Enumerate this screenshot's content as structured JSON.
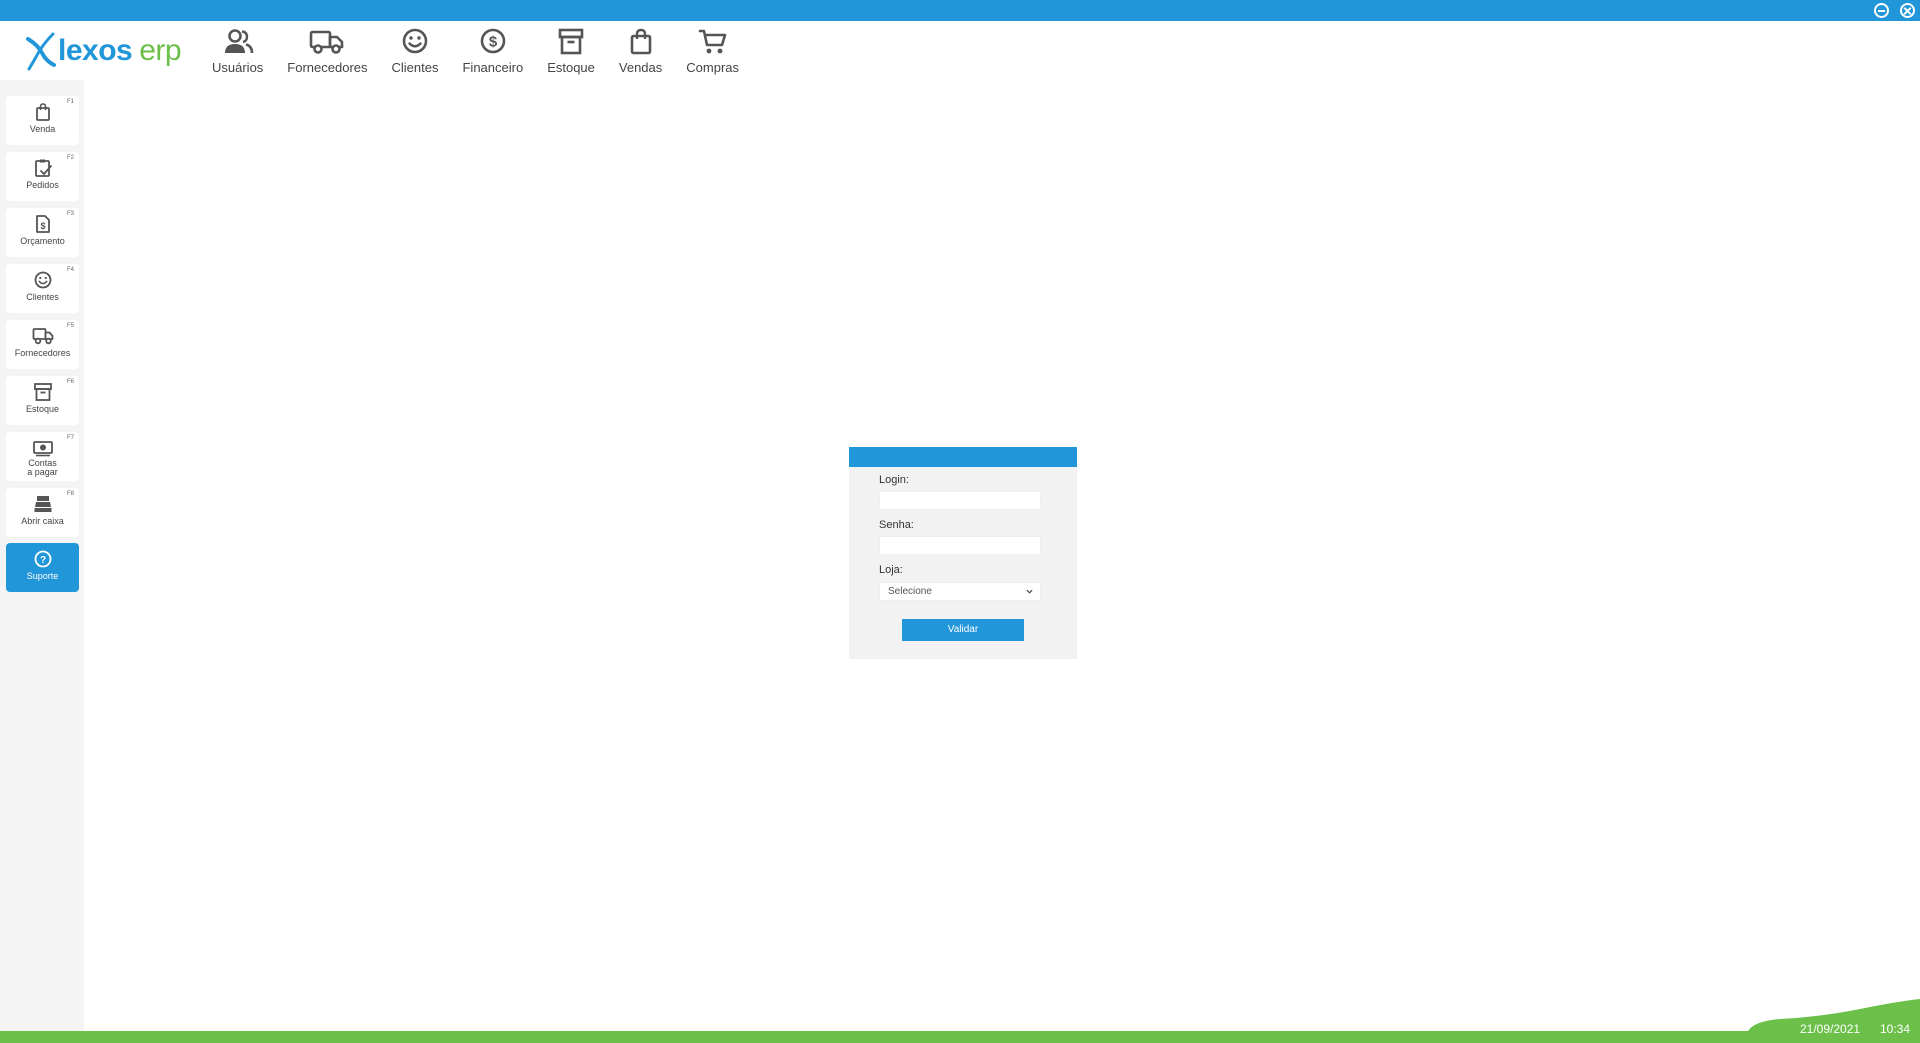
{
  "brand": {
    "logo_name": "lexos",
    "logo_suffix": "erp",
    "primary_color": "#2196d9",
    "accent_color": "#6cc04a"
  },
  "window_controls": [
    "minimize-icon",
    "close-icon"
  ],
  "topnav": {
    "items": [
      {
        "label": "Usuários",
        "icon": "users-icon"
      },
      {
        "label": "Fornecedores",
        "icon": "truck-icon"
      },
      {
        "label": "Clientes",
        "icon": "smile-icon"
      },
      {
        "label": "Financeiro",
        "icon": "dollar-icon"
      },
      {
        "label": "Estoque",
        "icon": "archive-icon"
      },
      {
        "label": "Vendas",
        "icon": "shopping-bag-icon"
      },
      {
        "label": "Compras",
        "icon": "cart-icon"
      }
    ]
  },
  "sidebar": {
    "items": [
      {
        "label": "Venda",
        "key": "F1",
        "icon": "shopping-bag-icon"
      },
      {
        "label": "Pedidos",
        "key": "F2",
        "icon": "clipboard-check-icon"
      },
      {
        "label": "Orçamento",
        "key": "F3",
        "icon": "invoice-icon"
      },
      {
        "label": "Clientes",
        "key": "F4",
        "icon": "smile-icon"
      },
      {
        "label": "Fornecedores",
        "key": "F5",
        "icon": "truck-icon"
      },
      {
        "label": "Estoque",
        "key": "F6",
        "icon": "archive-icon"
      },
      {
        "label_line1": "Contas",
        "label_line2": "a pagar",
        "key": "F7",
        "icon": "money-icon"
      },
      {
        "label": "Abrir caixa",
        "key": "F8",
        "icon": "cash-register-icon"
      },
      {
        "label": "Suporte",
        "icon": "help-icon",
        "active": true
      }
    ]
  },
  "login": {
    "login_label": "Login:",
    "password_label": "Senha:",
    "store_label": "Loja:",
    "store_select": "Selecione",
    "submit_label": "Validar"
  },
  "status": {
    "date": "21/09/2021",
    "time": "10:34"
  }
}
